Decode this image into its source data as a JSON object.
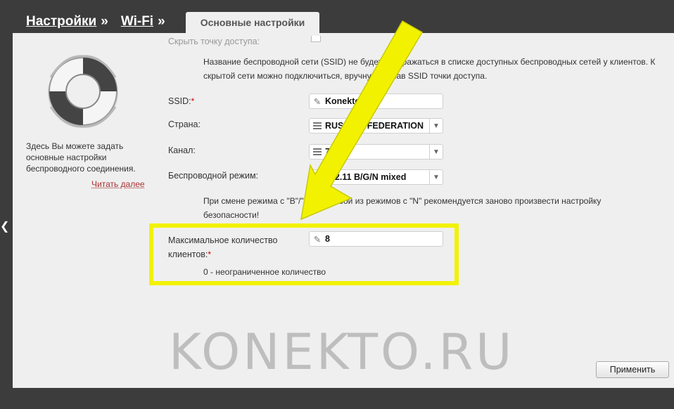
{
  "breadcrumb": {
    "settings": "Настройки",
    "wifi": "Wi-Fi",
    "separator": "»"
  },
  "tab": {
    "label": "Основные настройки"
  },
  "sidebar": {
    "description": "Здесь Вы можете задать основные настройки беспроводного соединения.",
    "read_more": "Читать далее"
  },
  "form": {
    "hide_ap_label": "Скрыть точку доступа:",
    "hide_ap_note": "Название беспроводной сети (SSID) не будет отображаться в списке доступных беспроводных сетей у клиентов. К скрытой сети можно подключиться, вручную указав SSID точки доступа.",
    "ssid_label": "SSID:",
    "ssid_value": "Konekto.R",
    "country_label": "Страна:",
    "country_value": "RUSSIAN FEDERATION",
    "channel_label": "Канал:",
    "channel_value": "7",
    "mode_label": "Беспроводной режим:",
    "mode_value": "802.11 B/G/N mixed",
    "mode_note": "При смене режима с \"B\"/\"G\" на любой из режимов с \"N\" рекомендуется заново произвести настройку безопасности!",
    "max_clients_label_1": "Максимальное количество",
    "max_clients_label_2": "клиентов:",
    "max_clients_value": "8",
    "max_clients_note": "0 - неограниченное количество",
    "required_mark": "*"
  },
  "watermark": "KONEKTO.RU",
  "apply_button": "Применить",
  "colors": {
    "highlight": "#f2f200",
    "arrow": "#f2f200",
    "panel": "#efefef",
    "background": "#3c3c3c"
  }
}
